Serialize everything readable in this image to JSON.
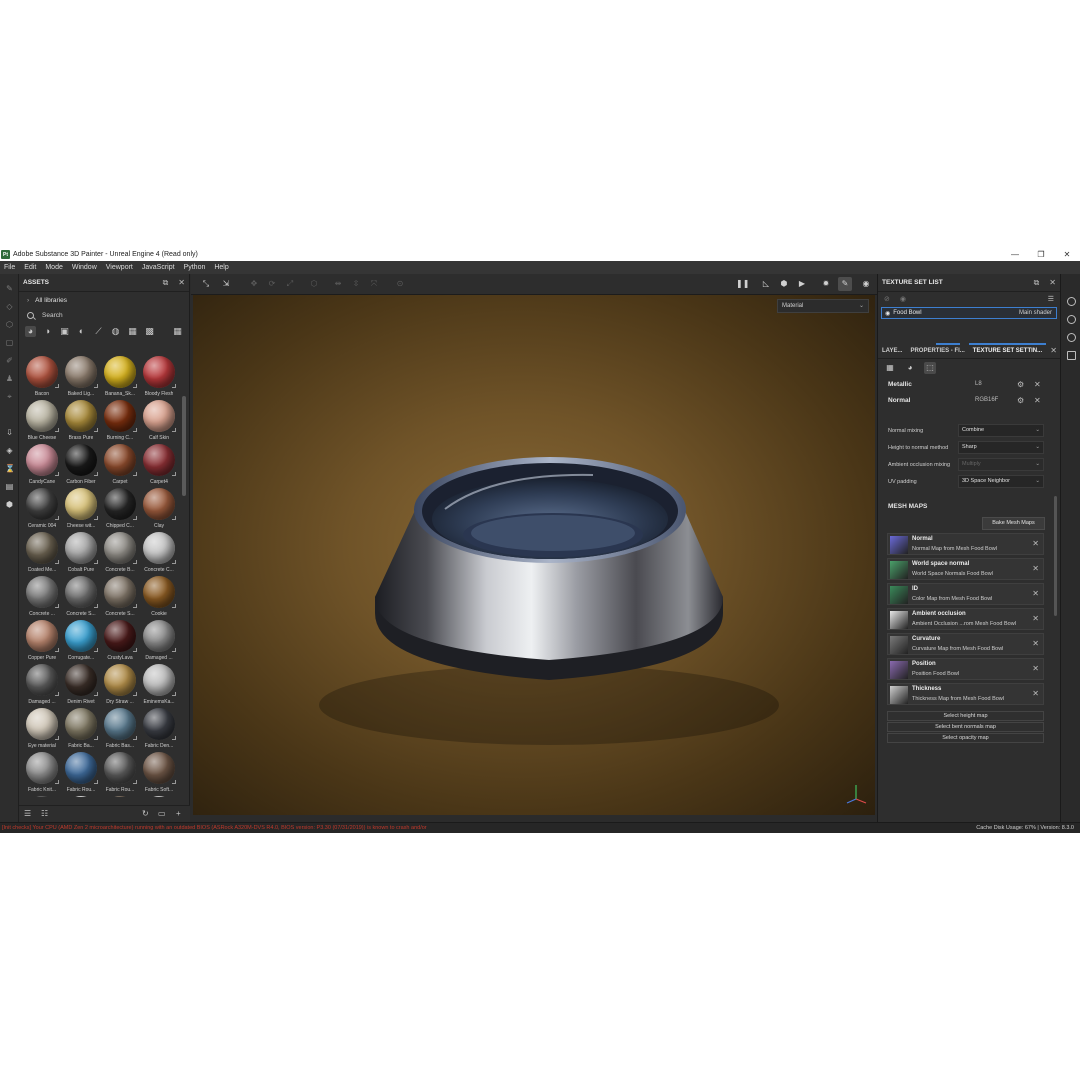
{
  "window": {
    "title": "Adobe Substance 3D Painter - Unreal Engine 4 (Read only)",
    "logo_text": "Pt",
    "controls": [
      "—",
      "❐",
      "✕"
    ]
  },
  "menu": [
    "File",
    "Edit",
    "Mode",
    "Window",
    "Viewport",
    "JavaScript",
    "Python",
    "Help"
  ],
  "assets": {
    "title": "ASSETS",
    "libraries": "All libraries",
    "search_placeholder": "Search",
    "materials": [
      {
        "name": "Bacon",
        "color": "#b0533f"
      },
      {
        "name": "Baked Lig...",
        "color": "#8b7b6c"
      },
      {
        "name": "Banana_Sk...",
        "color": "#d6b21e"
      },
      {
        "name": "Bloody Flesh",
        "color": "#b8383b"
      },
      {
        "name": "Blue Cheese",
        "color": "#b9b4a2"
      },
      {
        "name": "Brass Pure",
        "color": "#a88a3a"
      },
      {
        "name": "Burning C...",
        "color": "#7a2e0e"
      },
      {
        "name": "Calf Skin",
        "color": "#d9a28f"
      },
      {
        "name": "CandyCane",
        "color": "#c98a96"
      },
      {
        "name": "Carbon Fiber",
        "color": "#1a1a1a"
      },
      {
        "name": "Carpet",
        "color": "#8b4a2c"
      },
      {
        "name": "Carpet4",
        "color": "#8a2f34"
      },
      {
        "name": "Ceramic 004",
        "color": "#404040"
      },
      {
        "name": "Cheese wit...",
        "color": "#d8c27a"
      },
      {
        "name": "Chipped C...",
        "color": "#262626"
      },
      {
        "name": "Clay",
        "color": "#9a5a3c"
      },
      {
        "name": "Coated Me...",
        "color": "#6a6150"
      },
      {
        "name": "Cobalt Pure",
        "color": "#a6a6a6"
      },
      {
        "name": "Concrete B...",
        "color": "#8d8a84"
      },
      {
        "name": "Concrete C...",
        "color": "#c4c4c4"
      },
      {
        "name": "Concrete ...",
        "color": "#7a7a7a"
      },
      {
        "name": "Concrete S...",
        "color": "#6e6e6e"
      },
      {
        "name": "Concrete S...",
        "color": "#7f7467"
      },
      {
        "name": "Cookie",
        "color": "#8a5a22"
      },
      {
        "name": "Copper Pure",
        "color": "#b6836c"
      },
      {
        "name": "Corrugate...",
        "color": "#3aa0d0"
      },
      {
        "name": "CrustyLava",
        "color": "#4a1a1a"
      },
      {
        "name": "Damaged ...",
        "color": "#8a8a8a"
      },
      {
        "name": "Damaged ...",
        "color": "#5a5a5a"
      },
      {
        "name": "Denim Rivet",
        "color": "#3a2e28"
      },
      {
        "name": "Dry Straw ...",
        "color": "#b08c48"
      },
      {
        "name": "EminemsKa...",
        "color": "#bcbcbc"
      },
      {
        "name": "Eye material",
        "color": "#d0c7b8"
      },
      {
        "name": "Fabric Ba...",
        "color": "#7f7863"
      },
      {
        "name": "Fabric Bas...",
        "color": "#5a7a8e"
      },
      {
        "name": "Fabric Den...",
        "color": "#3a3d44"
      },
      {
        "name": "Fabric Knit...",
        "color": "#8d8d8d"
      },
      {
        "name": "Fabric Rou...",
        "color": "#3e6a9a"
      },
      {
        "name": "Fabric Rou...",
        "color": "#5a5a5a"
      },
      {
        "name": "Fabric Soft...",
        "color": "#6e5646"
      },
      {
        "name": "",
        "color": "#4a4a4a"
      },
      {
        "name": "",
        "color": "#d8d8d8"
      },
      {
        "name": "",
        "color": "#6a5a4a"
      },
      {
        "name": "",
        "color": "#c8c8c8"
      }
    ]
  },
  "viewport": {
    "mode": "Material"
  },
  "texture_set_list": {
    "title": "TEXTURE SET LIST",
    "item_name": "Food Bowl",
    "item_shader": "Main shader"
  },
  "tabs": [
    "LAYE...",
    "PROPERTIES - FI...",
    "TEXTURE SET SETTIN..."
  ],
  "texture_set_settings": {
    "channels": [
      {
        "name": "Metallic",
        "format": "L8"
      },
      {
        "name": "Normal",
        "format": "RGB16F"
      }
    ],
    "params": [
      {
        "label": "Normal mixing",
        "value": "Combine",
        "disabled": false
      },
      {
        "label": "Height to normal method",
        "value": "Sharp",
        "disabled": false
      },
      {
        "label": "Ambient occlusion mixing",
        "value": "Multiply",
        "disabled": true
      },
      {
        "label": "UV padding",
        "value": "3D Space Neighbor",
        "disabled": false
      }
    ],
    "mesh_maps_title": "MESH MAPS",
    "bake_button": "Bake Mesh Maps",
    "mesh_maps": [
      {
        "name": "Normal",
        "desc": "Normal Map from Mesh Food Bowl",
        "color": "#6a6ad8"
      },
      {
        "name": "World space normal",
        "desc": "World Space Normals Food Bowl",
        "color": "#4aa06a"
      },
      {
        "name": "ID",
        "desc": "Color Map from Mesh Food Bowl",
        "color": "#3a8a5a"
      },
      {
        "name": "Ambient occlusion",
        "desc": "Ambient Occlusion ...rom Mesh Food Bowl",
        "color": "#e8e8e8"
      },
      {
        "name": "Curvature",
        "desc": "Curvature Map from Mesh Food Bowl",
        "color": "#7a7a7a"
      },
      {
        "name": "Position",
        "desc": "Position Food Bowl",
        "color": "#8a6ab0"
      },
      {
        "name": "Thickness",
        "desc": "Thickness Map from Mesh Food Bowl",
        "color": "#d0d0d0"
      }
    ],
    "select_buttons": [
      "Select height map",
      "Select bent normals map",
      "Select opacity map"
    ]
  },
  "statusbar": {
    "error": "[Init checks] Your CPU (AMD Zen 2 microarchitecture) running with an outdated BIOS (ASRock A320M-DVS R4.0, BIOS version: P3.30 (07/31/2019)) is known to crash and/or",
    "info": "Cache Disk Usage:    67% | Version: 8.3.0"
  }
}
